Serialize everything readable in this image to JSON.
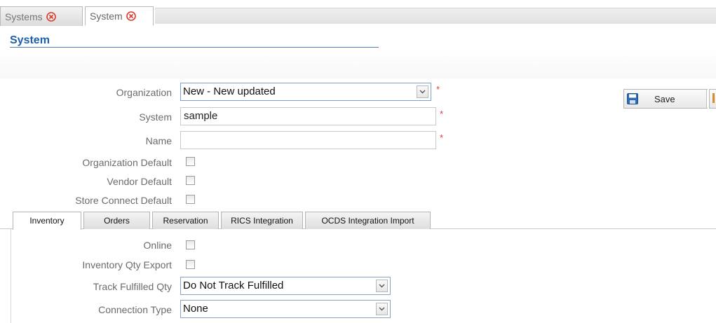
{
  "doc_tabs": [
    {
      "label": "Systems"
    },
    {
      "label": "System"
    }
  ],
  "page": {
    "title": "System"
  },
  "toolbar": {
    "save_label": "Save"
  },
  "form": {
    "organization": {
      "label": "Organization",
      "value": "New - New updated",
      "required": "*"
    },
    "system": {
      "label": "System",
      "value": "sample",
      "required": "*"
    },
    "name": {
      "label": "Name",
      "value": "",
      "required": "*"
    },
    "organization_default": {
      "label": "Organization Default"
    },
    "vendor_default": {
      "label": "Vendor Default"
    },
    "store_connect_default": {
      "label": "Store Connect Default"
    }
  },
  "section_tabs": [
    {
      "label": "Inventory"
    },
    {
      "label": "Orders"
    },
    {
      "label": "Reservation"
    },
    {
      "label": "RICS Integration"
    },
    {
      "label": "OCDS Integration Import"
    }
  ],
  "inventory": {
    "online": {
      "label": "Online"
    },
    "qty_export": {
      "label": "Inventory Qty Export"
    },
    "track_fulfilled": {
      "label": "Track Fulfilled Qty",
      "value": "Do Not Track Fulfilled"
    },
    "connection_type": {
      "label": "Connection Type",
      "value": "None"
    }
  },
  "colors": {
    "accent": "#1e5fa8",
    "required": "#e03a3a",
    "close_icon": "#d93a2b"
  }
}
